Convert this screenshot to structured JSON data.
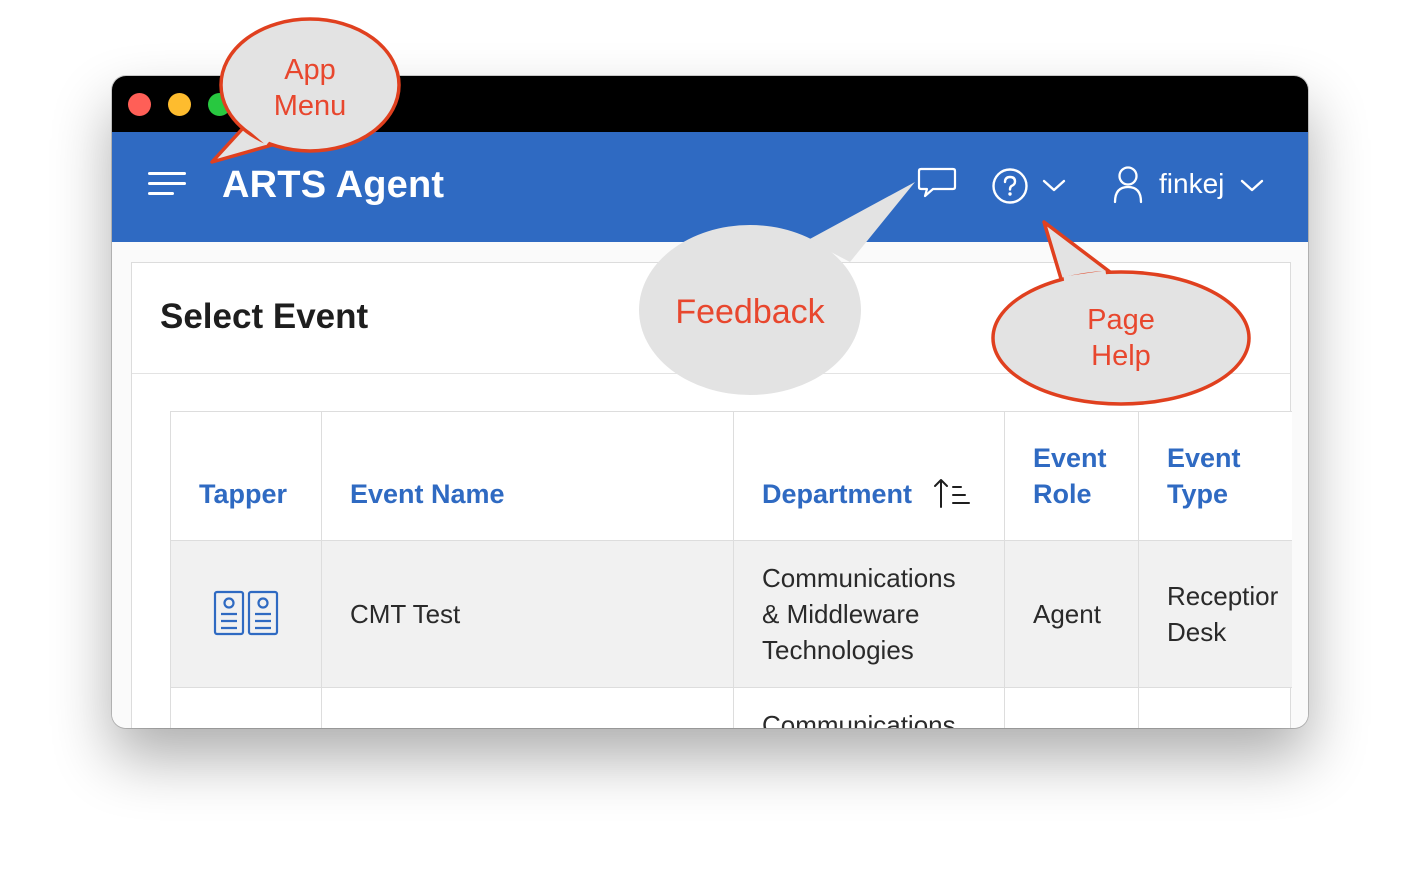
{
  "app": {
    "title": "ARTS Agent",
    "user": "finkej"
  },
  "page": {
    "title": "Select Event"
  },
  "table": {
    "headers": [
      "Tapper",
      "Event Name",
      "Department",
      "Event\nRole",
      "Event\nType"
    ],
    "rows": [
      {
        "event_name": "CMT Test",
        "department": "Communications\n& Middleware\nTechnologies",
        "event_role": "Agent",
        "event_type": "Receptior\nDesk"
      },
      {
        "event_name": "",
        "department": "Communications",
        "event_role": "",
        "event_type": ""
      }
    ]
  },
  "callouts": {
    "app_menu": "App\nMenu",
    "feedback": "Feedback",
    "page_help": "Page\nHelp"
  },
  "icons": {
    "menu": "hamburger-menu-icon",
    "feedback": "speech-bubble-icon",
    "help": "question-circle-icon",
    "user": "person-icon",
    "chevron": "chevron-down-icon",
    "sort": "sort-ascending-icon",
    "tapper": "badge-pair-icon"
  },
  "colors": {
    "header": "#2f6ac2",
    "link": "#2f6ac2",
    "callout_text": "#e8472e",
    "callout_fill": "#e3e3e3",
    "callout_stroke": "#e0401f"
  }
}
